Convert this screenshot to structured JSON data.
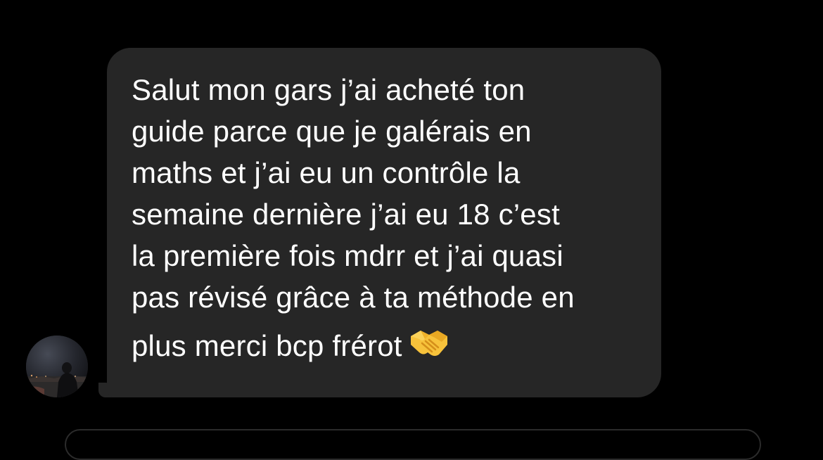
{
  "conversation": {
    "avatar": {
      "icon": "user-avatar-night-photo-icon"
    },
    "message": {
      "lines": [
        "Salut mon gars j’ai acheté ton",
        "guide parce que je galérais en",
        "maths et j’ai eu un contrôle la",
        "semaine dernière j’ai eu 18 c’est",
        "la première fois mdrr et j’ai quasi",
        "pas révisé grâce à ta méthode en",
        "plus merci bcp frérot"
      ],
      "emoji": {
        "icon": "handshake-emoji-icon"
      }
    }
  },
  "colors": {
    "background": "#000000",
    "bubble": "#262626",
    "text": "#ffffff",
    "emoji": "#f7c23b"
  }
}
